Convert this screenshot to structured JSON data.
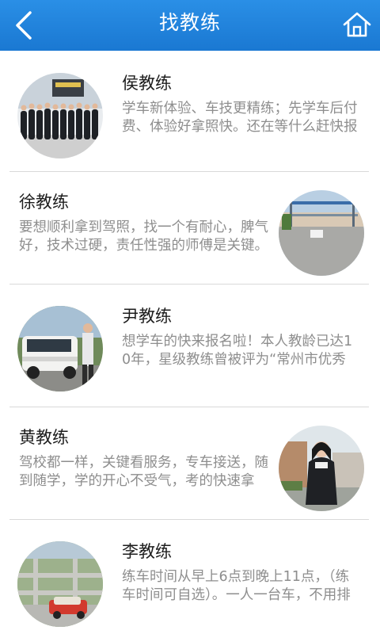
{
  "header": {
    "title": "找教练",
    "back_icon": "chevron-left-icon",
    "home_icon": "home-icon",
    "color": "#1f82dc"
  },
  "coaches": [
    {
      "name": "侯教练",
      "description": "学车新体验、车技更精练；先学车后付费、体验好拿照快。还在等什么赶快报名吧！",
      "avatar": "team-photo"
    },
    {
      "name": "徐教练",
      "description": "要想顺利拿到驾照，找一个有耐心，脾气好，技术过硬，责任性强的师傅是关键。",
      "avatar": "training-ground-photo"
    },
    {
      "name": "尹教练",
      "description": "想学车的快来报名啦！本人教龄已达10年，星级教练曾被评为“常州市优秀教练员”。",
      "avatar": "car-and-coach-photo"
    },
    {
      "name": "黄教练",
      "description": "驾校都一样，关键看服务，专车接送，随到随学，学的开心不受气，考的快速拿证。",
      "avatar": "woman-portrait-photo"
    },
    {
      "name": "李教练",
      "description": "练车时间从早上6点到晚上11点，（练车时间可自选）。一人一台车，不用排队等待。",
      "avatar": "driving-field-photo"
    }
  ]
}
